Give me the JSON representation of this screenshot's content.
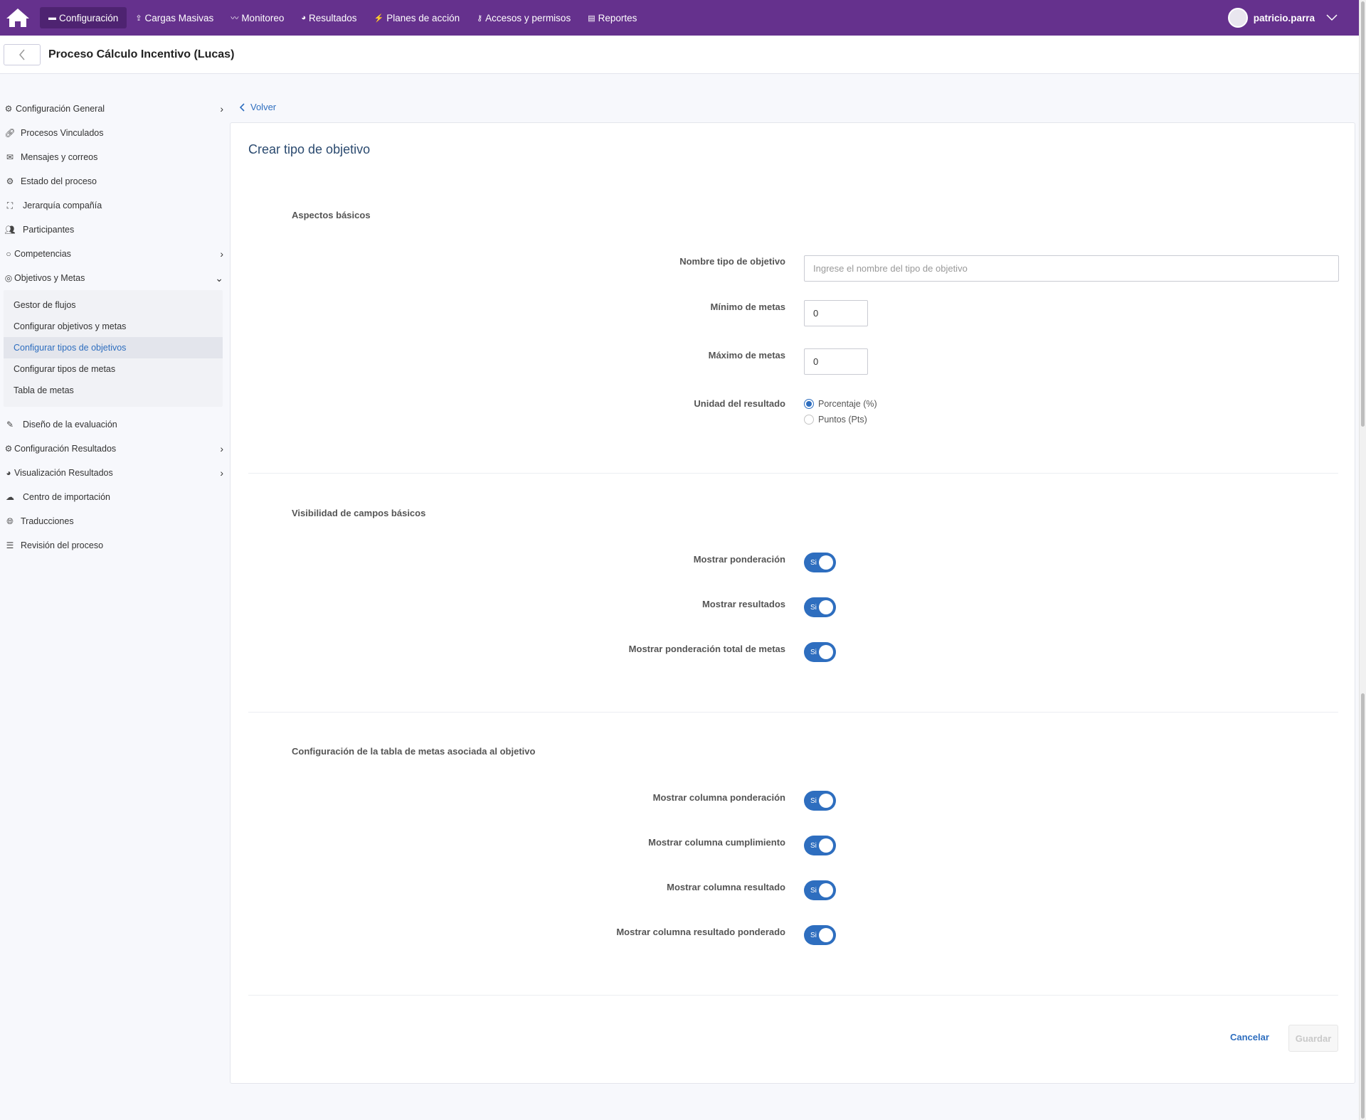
{
  "topbar": {
    "home_icon": "home-icon",
    "nav": [
      {
        "label": "Configuración",
        "icon": "briefcase-icon",
        "active": true
      },
      {
        "label": "Cargas Masivas",
        "icon": "upload-icon"
      },
      {
        "label": "Monitoreo",
        "icon": "chart-line-icon"
      },
      {
        "label": "Resultados",
        "icon": "pie-icon"
      },
      {
        "label": "Planes de acción",
        "icon": "bolt-icon"
      },
      {
        "label": "Accesos y permisos",
        "icon": "key-icon"
      },
      {
        "label": "Reportes",
        "icon": "file-icon"
      }
    ],
    "user": "patricio.parra"
  },
  "header": {
    "title": "Proceso Cálculo Incentivo (Lucas)"
  },
  "sidebar": {
    "items": [
      {
        "label": "Configuración General",
        "icon": "gear-icon",
        "chevron": "right"
      },
      {
        "label": "Procesos Vinculados",
        "icon": "link-icon"
      },
      {
        "label": "Mensajes y correos",
        "icon": "envelope-icon"
      },
      {
        "label": "Estado del proceso",
        "icon": "gear-icon"
      },
      {
        "label": "Jerarquía compañía",
        "icon": "sitemap-icon"
      },
      {
        "label": "Participantes",
        "icon": "users-icon"
      },
      {
        "label": "Competencias",
        "icon": "circle-icon",
        "chevron": "right"
      },
      {
        "label": "Objetivos y Metas",
        "icon": "target-icon",
        "chevron": "down"
      }
    ],
    "submenu": [
      "Gestor de flujos",
      "Configurar objetivos y metas",
      "Configurar tipos de objetivos",
      "Configurar tipos de metas",
      "Tabla de metas"
    ],
    "submenu_active": "Configurar tipos de objetivos",
    "items_after": [
      {
        "label": "Diseño de la evaluación",
        "icon": "edit-icon"
      },
      {
        "label": "Configuración Resultados",
        "icon": "gear-icon",
        "chevron": "right"
      },
      {
        "label": "Visualización Resultados",
        "icon": "pie-icon",
        "chevron": "right"
      },
      {
        "label": "Centro de importación",
        "icon": "cloud-upload-icon"
      },
      {
        "label": "Traducciones",
        "icon": "globe-icon"
      },
      {
        "label": "Revisión del proceso",
        "icon": "checklist-icon"
      }
    ]
  },
  "main": {
    "back_label": "Volver",
    "card_title": "Crear tipo de objetivo",
    "section1": {
      "title": "Aspectos básicos",
      "name_label": "Nombre tipo de objetivo",
      "name_placeholder": "Ingrese el nombre del tipo de objetivo",
      "min_label": "Mínimo de metas",
      "min_value": "0",
      "max_label": "Máximo de metas",
      "max_value": "0",
      "unit_label": "Unidad del resultado",
      "unit_options": [
        "Porcentaje (%)",
        "Puntos (Pts)"
      ],
      "unit_selected": "Porcentaje (%)"
    },
    "section2": {
      "title": "Visibilidad de campos básicos",
      "toggles": [
        {
          "label": "Mostrar ponderación",
          "state": "Si"
        },
        {
          "label": "Mostrar resultados",
          "state": "Si"
        },
        {
          "label": "Mostrar ponderación total de metas",
          "state": "Si"
        }
      ]
    },
    "section3": {
      "title": "Configuración de la tabla de metas asociada al objetivo",
      "toggles": [
        {
          "label": "Mostrar columna ponderación",
          "state": "Si"
        },
        {
          "label": "Mostrar columna cumplimiento",
          "state": "Si"
        },
        {
          "label": "Mostrar columna resultado",
          "state": "Si"
        },
        {
          "label": "Mostrar columna resultado ponderado",
          "state": "Si"
        }
      ]
    },
    "cancel_label": "Cancelar",
    "save_label": "Guardar"
  },
  "colors": {
    "brand": "#65318d",
    "accent": "#2e6ebf"
  }
}
